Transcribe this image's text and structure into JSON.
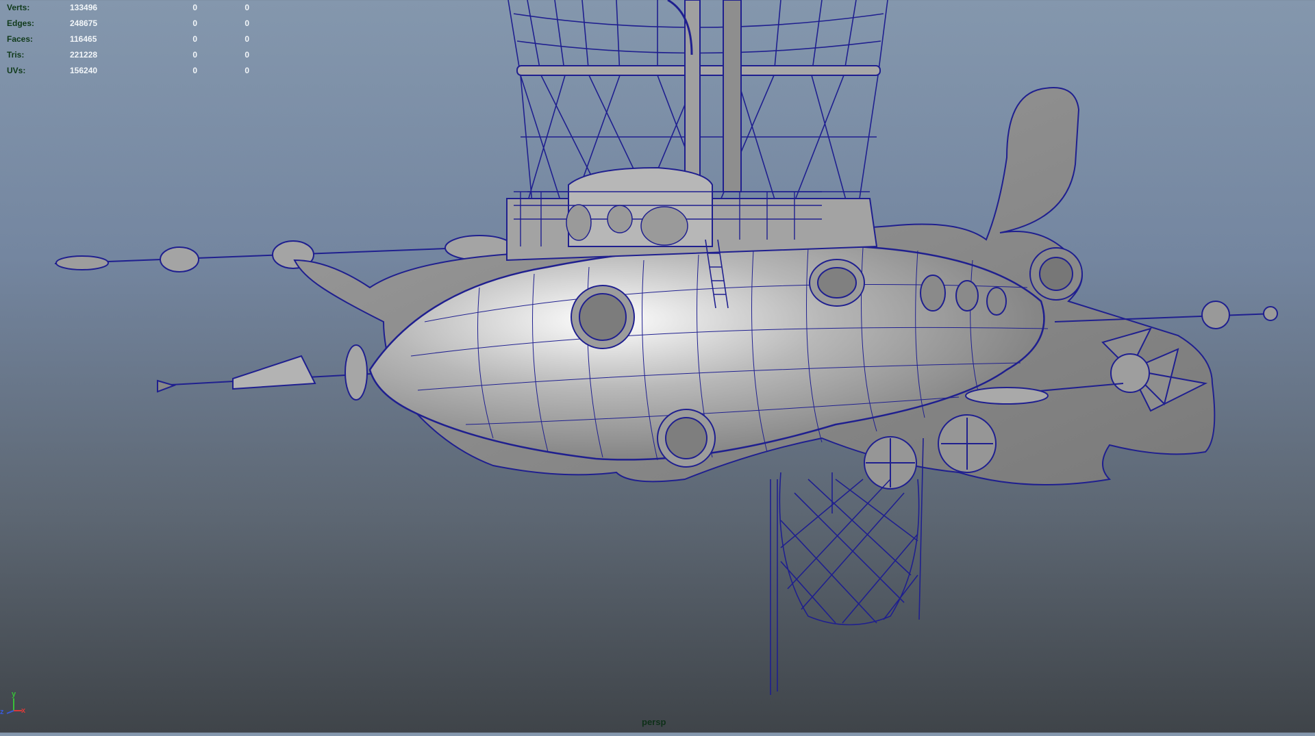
{
  "hud": {
    "rows": [
      {
        "label": "Verts:",
        "values": [
          "133496",
          "0",
          "0"
        ]
      },
      {
        "label": "Edges:",
        "values": [
          "248675",
          "0",
          "0"
        ]
      },
      {
        "label": "Faces:",
        "values": [
          "116465",
          "0",
          "0"
        ]
      },
      {
        "label": "Tris:",
        "values": [
          "221228",
          "0",
          "0"
        ]
      },
      {
        "label": "UVs:",
        "values": [
          "156240",
          "0",
          "0"
        ]
      }
    ]
  },
  "viewport": {
    "camera": "persp",
    "model": "steampunk-airship-wireframe"
  },
  "axis": {
    "x": "x",
    "y": "y",
    "z": "z"
  },
  "colors": {
    "wire": "#1f1f8f",
    "hud_label": "#103a1a",
    "hud_value": "#f2f6f9",
    "axis_x": "#d83a3a",
    "axis_y": "#38c038",
    "axis_z": "#3a5ad8"
  }
}
